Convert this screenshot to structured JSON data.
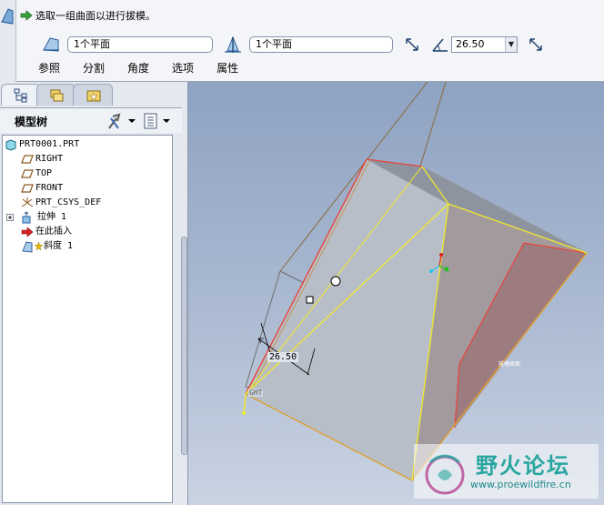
{
  "dashboard": {
    "prompt_message": "选取一组曲面以进行拔模。",
    "draft_surfaces_value": "1个平面",
    "draft_hinge_value": "1个平面",
    "draft_angle_value": "26.50",
    "tabs": [
      {
        "label": "参照"
      },
      {
        "label": "分割"
      },
      {
        "label": "角度"
      },
      {
        "label": "选项"
      },
      {
        "label": "属性"
      }
    ]
  },
  "navigator": {
    "tree_title": "模型树",
    "items": [
      {
        "label": "PRT0001.PRT",
        "icon": "part-icon"
      },
      {
        "label": "RIGHT",
        "icon": "datum-plane-icon"
      },
      {
        "label": "TOP",
        "icon": "datum-plane-icon"
      },
      {
        "label": "FRONT",
        "icon": "datum-plane-icon"
      },
      {
        "label": "PRT_CSYS_DEF",
        "icon": "csys-icon"
      },
      {
        "label": "拉伸 1",
        "icon": "extrude-icon"
      },
      {
        "label": "在此插入",
        "icon": "insert-here-arrow-icon"
      },
      {
        "label": "斜度 1",
        "icon": "draft-icon"
      }
    ]
  },
  "graphics": {
    "dimension_value": "26.50",
    "datum_tag": "GHT",
    "drag_handle_label": "拔模曲面"
  },
  "watermark": {
    "title": "野火论坛",
    "url": "www.proewildfire.cn"
  },
  "colors": {
    "edge_highlight": "#e8443a",
    "preview_yellow": "#f2ea2a",
    "watermark_teal": "#2aa6a0"
  }
}
